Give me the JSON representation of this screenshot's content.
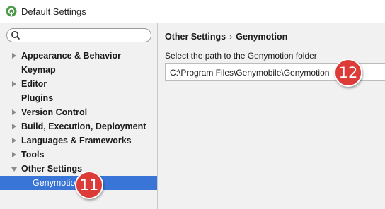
{
  "window": {
    "title": "Default Settings",
    "cutoff_text": "...",
    "app_icon": "android-studio-icon"
  },
  "search": {
    "value": "",
    "placeholder": ""
  },
  "tree": [
    {
      "label": "Appearance & Behavior",
      "arrow": "collapsed"
    },
    {
      "label": "Keymap",
      "arrow": "none"
    },
    {
      "label": "Editor",
      "arrow": "collapsed"
    },
    {
      "label": "Plugins",
      "arrow": "none"
    },
    {
      "label": "Version Control",
      "arrow": "collapsed"
    },
    {
      "label": "Build, Execution, Deployment",
      "arrow": "collapsed"
    },
    {
      "label": "Languages & Frameworks",
      "arrow": "collapsed"
    },
    {
      "label": "Tools",
      "arrow": "collapsed"
    },
    {
      "label": "Other Settings",
      "arrow": "expanded"
    },
    {
      "label": "Genymotion",
      "arrow": "none",
      "selected": true,
      "child": true
    }
  ],
  "main": {
    "breadcrumb_parent": "Other Settings",
    "breadcrumb_separator": "›",
    "breadcrumb_current": "Genymotion",
    "field_label": "Select the path to the Genymotion folder",
    "path_value": "C:\\Program Files\\Genymobile\\Genymotion"
  },
  "badges": {
    "badge_11": "11",
    "badge_12": "12"
  },
  "colors": {
    "selection": "#3875d6",
    "badge": "#dc3b37",
    "pane_bg": "#f1f1f1"
  }
}
